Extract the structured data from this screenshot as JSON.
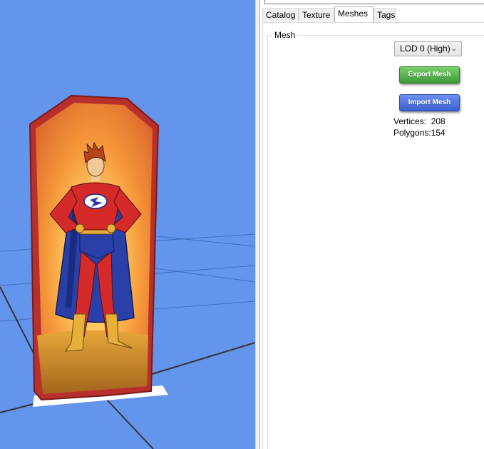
{
  "tabs": [
    {
      "label": "Catalog",
      "active": false
    },
    {
      "label": "Texture",
      "active": false
    },
    {
      "label": "Meshes",
      "active": true
    },
    {
      "label": "Tags",
      "active": false
    }
  ],
  "mesh_group": {
    "title": "Mesh",
    "lod_select": {
      "value": "LOD 0 (High)"
    },
    "export_button": "Export Mesh",
    "import_button": "Import Mesh",
    "vertices_label": "Vertices:",
    "vertices_value": "208",
    "polygons_label": "Polygons:",
    "polygons_value": "154"
  },
  "viewport": {
    "background_color": "#6495ED",
    "object": "superhero card standee"
  },
  "colors": {
    "export_button": "#4CAF50",
    "import_button": "#4A6FE0",
    "card_frame": "#B8302C",
    "card_glow": "#F29A38"
  }
}
